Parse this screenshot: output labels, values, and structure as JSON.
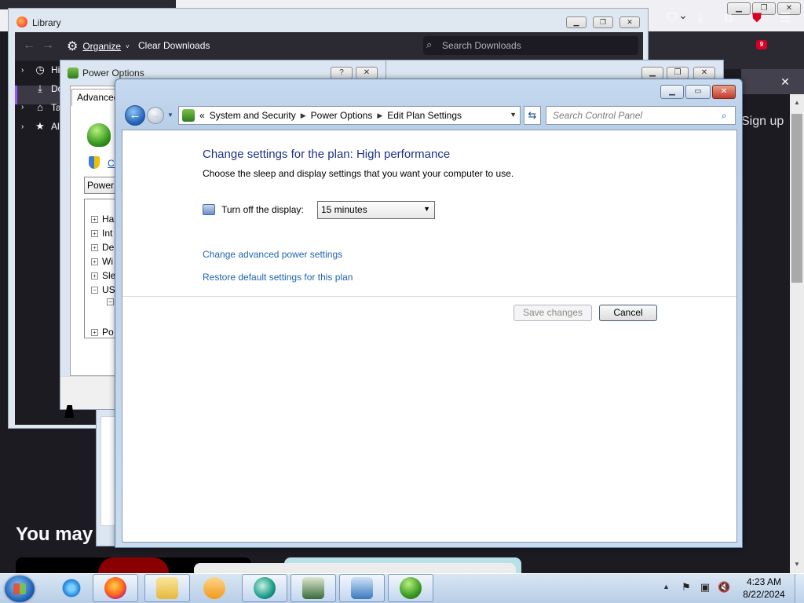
{
  "firefox": {
    "sign_up": "Sign up",
    "you_may_also": "You may als",
    "badge_count": "9",
    "icons": [
      "chevron-down-icon",
      "pocket-icon",
      "download-icon",
      "extensions-icon",
      "ublock-icon",
      "hamburger-menu-icon",
      "close-icon"
    ]
  },
  "library": {
    "title": "Library",
    "organize_label": "Organize",
    "clear_downloads_label": "Clear Downloads",
    "search_placeholder": "Search Downloads",
    "tree": [
      {
        "label": "Hi",
        "icon": "history-icon"
      },
      {
        "label": "Do",
        "icon": "download-icon"
      },
      {
        "label": "Ta",
        "icon": "tag-icon"
      },
      {
        "label": "All",
        "icon": "star-icon"
      }
    ]
  },
  "power_adv": {
    "title": "Power Options",
    "tab_label": "Advanced",
    "link_label": "Ch",
    "select_label": "Power",
    "tree_rows": [
      {
        "label": "Ha",
        "expanded": false
      },
      {
        "label": "Int",
        "expanded": false
      },
      {
        "label": "De",
        "expanded": false
      },
      {
        "label": "Wi",
        "expanded": false
      },
      {
        "label": "Sle",
        "expanded": false
      },
      {
        "label": "US",
        "expanded": true
      },
      {
        "label": "",
        "expanded": true
      },
      {
        "label": "Po",
        "expanded": false
      }
    ]
  },
  "control_panel": {
    "breadcrumb": {
      "chevrons": "«",
      "items": [
        "System and Security",
        "Power Options",
        "Edit Plan Settings"
      ]
    },
    "search_placeholder": "Search Control Panel",
    "heading": "Change settings for the plan: High performance",
    "subheading": "Choose the sleep and display settings that you want your computer to use.",
    "display_label": "Turn off the display:",
    "display_value": "15 minutes",
    "advanced_link": "Change advanced power settings",
    "restore_link": "Restore default settings for this plan",
    "save_label": "Save changes",
    "cancel_label": "Cancel"
  },
  "taskbar": {
    "apps": [
      "Internet Explorer",
      "Firefox",
      "Windows Explorer",
      "Windows Media Player",
      "App",
      "Task Manager",
      "Remote Desktop",
      "Power Options"
    ],
    "clock_time": "4:23 AM",
    "clock_date": "8/22/2024"
  }
}
